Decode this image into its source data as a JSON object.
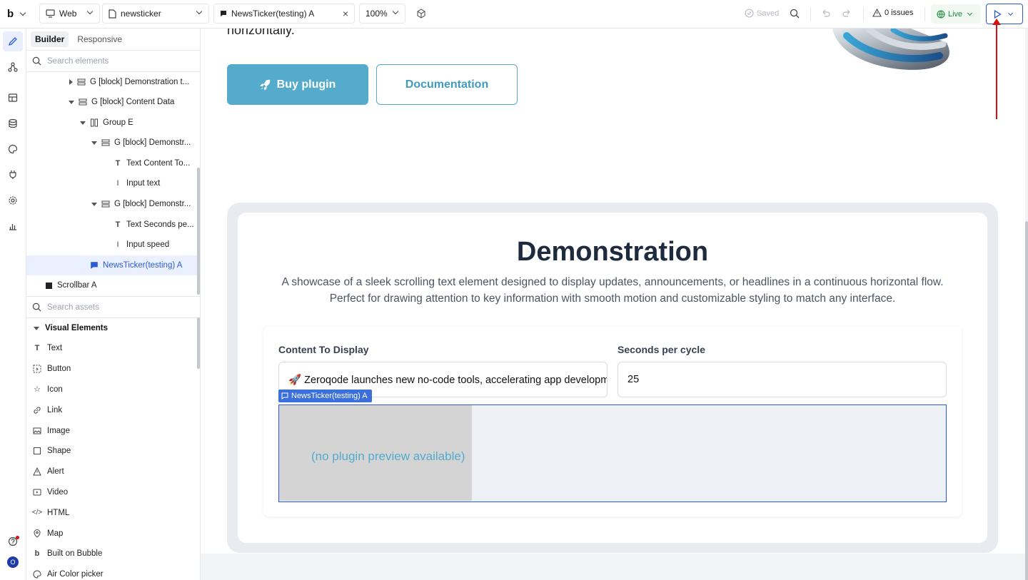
{
  "topbar": {
    "logo": "b",
    "platform": "Web",
    "page": "newsticker",
    "element_tab": "NewsTicker(testing) A",
    "zoom": "100%",
    "saved": "Saved",
    "issues": "0 issues",
    "live": "Live"
  },
  "rail": {
    "avatar": "O"
  },
  "panel": {
    "tabs": [
      "Builder",
      "Responsive"
    ],
    "search_placeholder": "Search elements",
    "tree": [
      {
        "label": "G [block] Demonstration t..."
      },
      {
        "label": "G [block] Content Data"
      },
      {
        "label": "Group E"
      },
      {
        "label": "G [block] Demonstr..."
      },
      {
        "label": "Text Content To..."
      },
      {
        "label": "Input text"
      },
      {
        "label": "G [block] Demonstr..."
      },
      {
        "label": "Text Seconds pe..."
      },
      {
        "label": "Input speed"
      },
      {
        "label": "NewsTicker(testing) A"
      },
      {
        "label": "Scrollbar A"
      }
    ],
    "assets_placeholder": "Search assets",
    "assets_heading": "Visual Elements",
    "assets": [
      "Text",
      "Button",
      "Icon",
      "Link",
      "Image",
      "Shape",
      "Alert",
      "Video",
      "HTML",
      "Map",
      "Built on Bubble",
      "Air Color picker"
    ]
  },
  "canvas": {
    "hero_text": "horizontally.",
    "buy_button": "Buy plugin",
    "doc_button": "Documentation",
    "demo_title": "Demonstration",
    "demo_desc_1": "A showcase of a sleek scrolling text element designed to display updates, announcements, or headlines in a continuous horizontal flow.",
    "demo_desc_2": "Perfect for drawing attention to key information with smooth motion and customizable styling to match any interface.",
    "content_label": "Content To Display",
    "content_value": "🚀 Zeroqode launches new no-code tools, accelerating app development",
    "speed_label": "Seconds per cycle",
    "speed_value": "25",
    "ticker_tag": "NewsTicker(testing) A",
    "ticker_placeholder": "(no plugin preview available)"
  },
  "colors": {
    "accent": "#2a5bd7",
    "button_teal": "#54abcb",
    "live_green": "#1f8a3b",
    "annotation_red": "#d60f0f"
  }
}
